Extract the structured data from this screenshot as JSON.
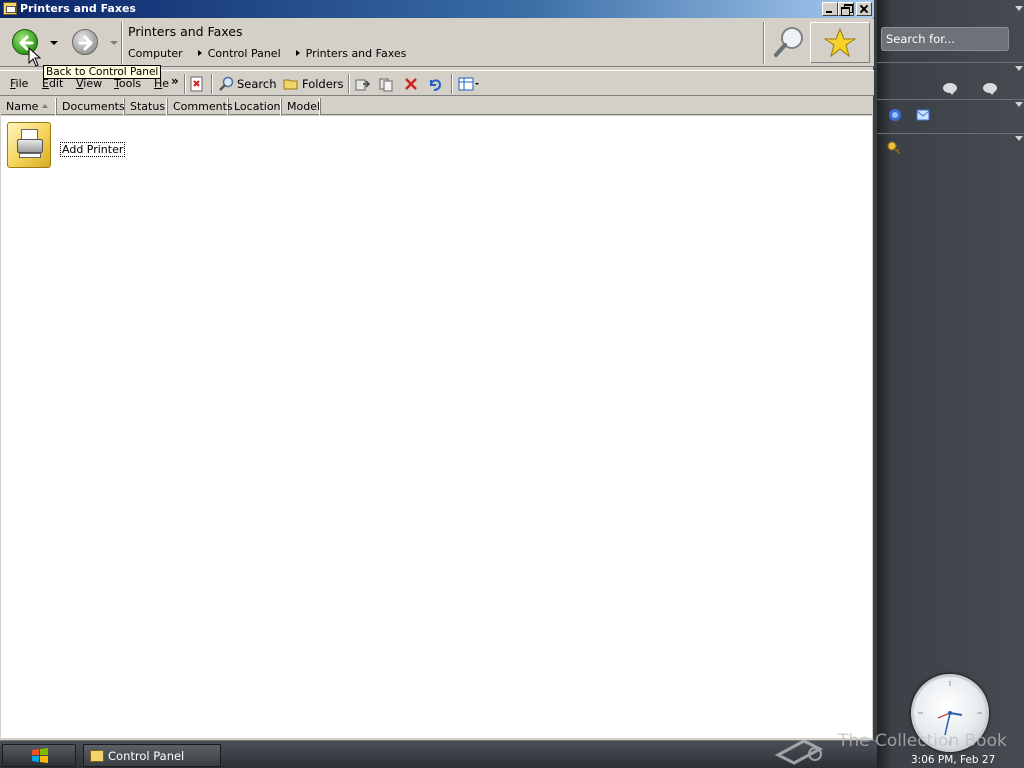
{
  "window": {
    "title": "Printers and Faxes"
  },
  "navbar": {
    "location_title": "Printers and Faxes",
    "breadcrumb": [
      "Computer",
      "Control Panel",
      "Printers and Faxes"
    ],
    "back_tooltip": "Back to Control Panel"
  },
  "menu": [
    {
      "label": "File",
      "mnemonic": "F"
    },
    {
      "label": "Edit",
      "mnemonic": "E"
    },
    {
      "label": "View",
      "mnemonic": "V"
    },
    {
      "label": "Tools",
      "mnemonic": "T"
    },
    {
      "label": "He",
      "mnemonic": "H"
    }
  ],
  "toolbar": {
    "search_label": "Search",
    "folders_label": "Folders"
  },
  "columns": [
    {
      "label": "Name",
      "sorted": "asc"
    },
    {
      "label": "Documents"
    },
    {
      "label": "Status"
    },
    {
      "label": "Comments"
    },
    {
      "label": "Location"
    },
    {
      "label": "Model"
    }
  ],
  "items": [
    {
      "label": "Add Printer",
      "icon": "add-printer-icon"
    }
  ],
  "sidebar": {
    "search_placeholder": "Search for...",
    "clock_text": "3:06 PM, Feb 27"
  },
  "taskbar": {
    "task_label": "Control Panel"
  },
  "watermark": "The Collection Book"
}
